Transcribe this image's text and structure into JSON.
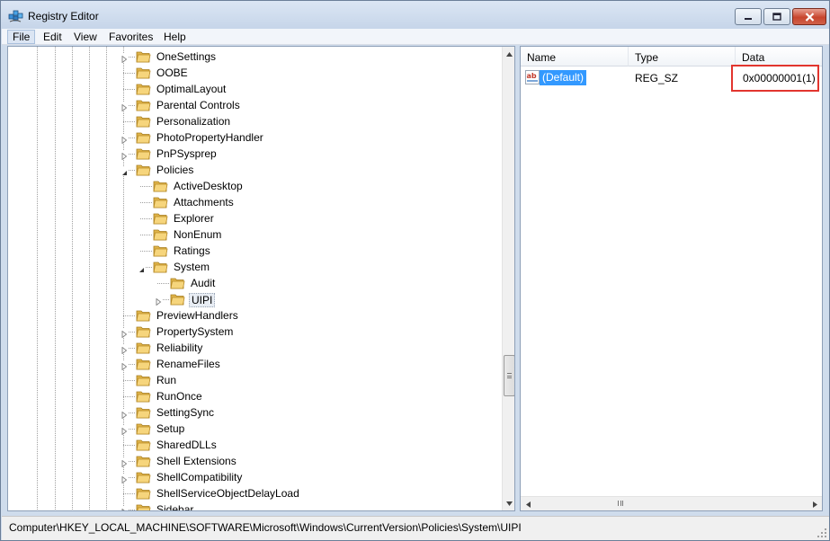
{
  "window": {
    "title": "Registry Editor"
  },
  "menu": [
    {
      "label": "File",
      "active": true
    },
    {
      "label": "Edit"
    },
    {
      "label": "View"
    },
    {
      "label": "Favorites"
    },
    {
      "label": "Help"
    }
  ],
  "tree": {
    "items": [
      {
        "label": "OneSettings",
        "level": 0,
        "expander": "collapsed"
      },
      {
        "label": "OOBE",
        "level": 0,
        "expander": "none"
      },
      {
        "label": "OptimalLayout",
        "level": 0,
        "expander": "none"
      },
      {
        "label": "Parental Controls",
        "level": 0,
        "expander": "collapsed"
      },
      {
        "label": "Personalization",
        "level": 0,
        "expander": "none"
      },
      {
        "label": "PhotoPropertyHandler",
        "level": 0,
        "expander": "collapsed"
      },
      {
        "label": "PnPSysprep",
        "level": 0,
        "expander": "collapsed"
      },
      {
        "label": "Policies",
        "level": 0,
        "expander": "expanded"
      },
      {
        "label": "ActiveDesktop",
        "level": 1,
        "expander": "none"
      },
      {
        "label": "Attachments",
        "level": 1,
        "expander": "none"
      },
      {
        "label": "Explorer",
        "level": 1,
        "expander": "none"
      },
      {
        "label": "NonEnum",
        "level": 1,
        "expander": "none"
      },
      {
        "label": "Ratings",
        "level": 1,
        "expander": "none"
      },
      {
        "label": "System",
        "level": 1,
        "expander": "expanded"
      },
      {
        "label": "Audit",
        "level": 2,
        "expander": "none"
      },
      {
        "label": "UIPI",
        "level": 2,
        "expander": "collapsed",
        "selected": true
      },
      {
        "label": "PreviewHandlers",
        "level": 0,
        "expander": "none"
      },
      {
        "label": "PropertySystem",
        "level": 0,
        "expander": "collapsed"
      },
      {
        "label": "Reliability",
        "level": 0,
        "expander": "collapsed"
      },
      {
        "label": "RenameFiles",
        "level": 0,
        "expander": "collapsed"
      },
      {
        "label": "Run",
        "level": 0,
        "expander": "none"
      },
      {
        "label": "RunOnce",
        "level": 0,
        "expander": "none"
      },
      {
        "label": "SettingSync",
        "level": 0,
        "expander": "collapsed"
      },
      {
        "label": "Setup",
        "level": 0,
        "expander": "collapsed"
      },
      {
        "label": "SharedDLLs",
        "level": 0,
        "expander": "none"
      },
      {
        "label": "Shell Extensions",
        "level": 0,
        "expander": "collapsed"
      },
      {
        "label": "ShellCompatibility",
        "level": 0,
        "expander": "collapsed"
      },
      {
        "label": "ShellServiceObjectDelayLoad",
        "level": 0,
        "expander": "none"
      },
      {
        "label": "Sidebar",
        "level": 0,
        "expander": "collapsed"
      }
    ]
  },
  "list": {
    "columns": {
      "name": "Name",
      "type": "Type",
      "data": "Data"
    },
    "rows": [
      {
        "name": "(Default)",
        "type": "REG_SZ",
        "data": "0x00000001(1)",
        "icon": "string-value-icon"
      }
    ],
    "highlight_color": "#e2352e",
    "selection_color": "#3399ff"
  },
  "status": {
    "path": "Computer\\HKEY_LOCAL_MACHINE\\SOFTWARE\\Microsoft\\Windows\\CurrentVersion\\Policies\\System\\UIPI"
  },
  "icons": {
    "folder": "folder-icon",
    "expand": "triangle-expander-icon"
  }
}
